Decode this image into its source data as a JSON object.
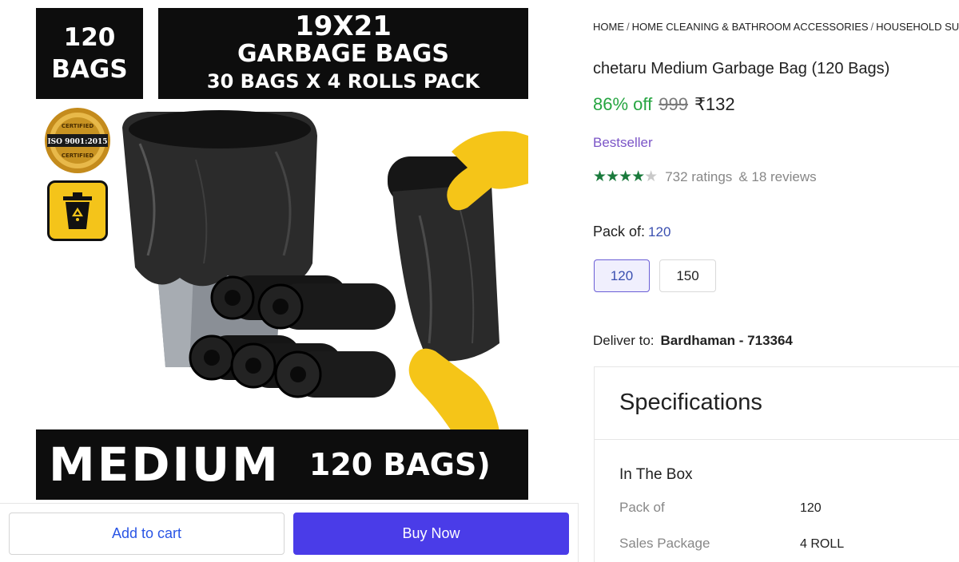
{
  "product_image": {
    "badge_count": "120",
    "badge_unit": "BAGS",
    "title_line1": "19X21",
    "title_line2": "GARBAGE BAGS",
    "title_line3": "30 BAGS X  4 ROLLS PACK",
    "seal_top": "CERTIFIED",
    "seal_middle": "ISO 9001:2015",
    "seal_bottom": "CERTIFIED",
    "banner_big": "MEDIUM",
    "banner_small": "120 BAGS)"
  },
  "actions": {
    "add_to_cart": "Add to cart",
    "buy_now": "Buy Now"
  },
  "breadcrumb": {
    "items": [
      "HOME",
      "HOME CLEANING & BATHROOM ACCESSORIES",
      "HOUSEHOLD SUPPLIES"
    ],
    "separator": "/"
  },
  "product": {
    "title": "chetaru Medium Garbage Bag (120 Bags)",
    "discount": "86% off",
    "mrp": "999",
    "price": "₹132",
    "badge": "Bestseller",
    "stars": "★★★★★",
    "rating_value": 4.5,
    "ratings_text": "732 ratings",
    "reviews_text": "& 18 reviews"
  },
  "pack": {
    "label": "Pack of:",
    "selected": "120",
    "options": [
      "120",
      "150"
    ]
  },
  "delivery": {
    "label": "Deliver to:",
    "location": "Bardhaman - 713364"
  },
  "specifications": {
    "heading": "Specifications",
    "section": "In The Box",
    "rows": [
      {
        "key": "Pack of",
        "value": "120"
      },
      {
        "key": "Sales Package",
        "value": "4 ROLL"
      }
    ]
  },
  "colors": {
    "accent": "#4a3ce8",
    "discount_green": "#26a541",
    "star_green": "#1a7a3c",
    "bestseller_purple": "#7b55c7",
    "glove_yellow": "#f5c518"
  }
}
